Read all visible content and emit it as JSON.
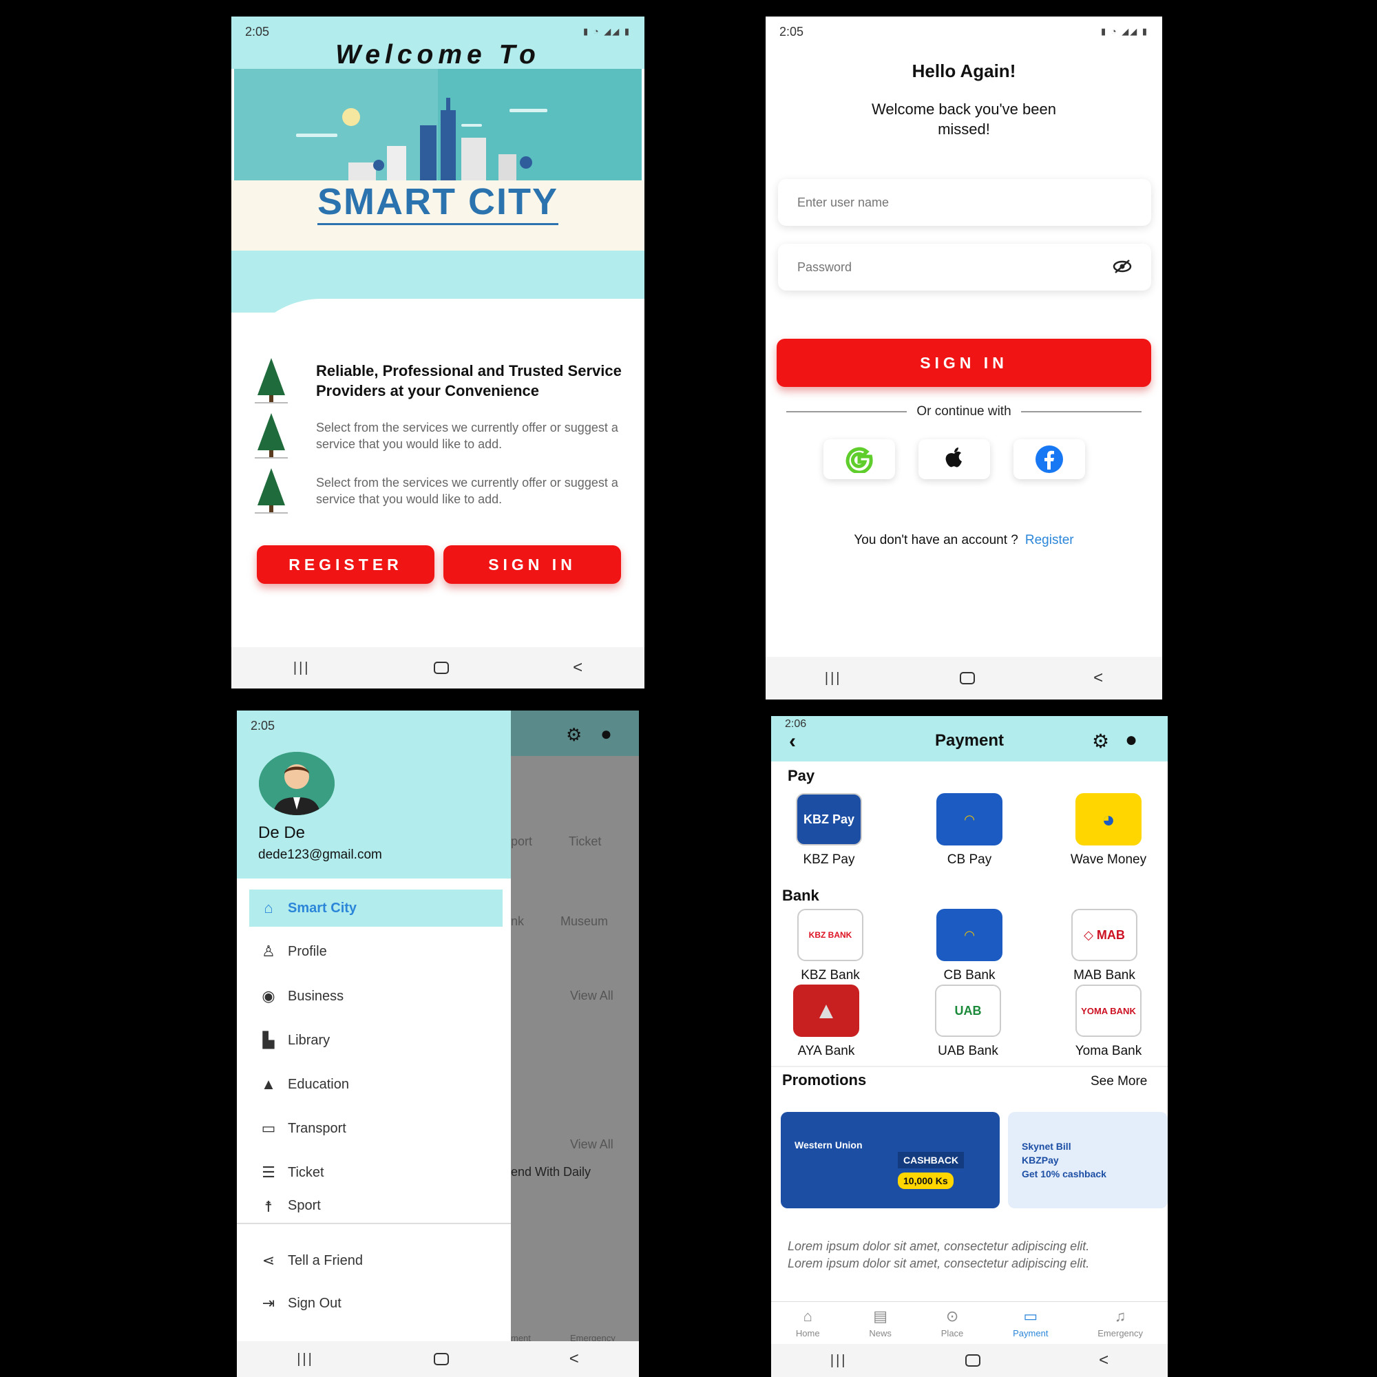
{
  "status_time_a": "2:05",
  "status_time_b": "2:06",
  "screen_welcome": {
    "heading": "Welcome To",
    "logo": "SMART CITY",
    "feature_title": "Reliable, Professional and Trusted Service Providers at your Convenience",
    "feature_text_1": "Select from the services we currently offer or suggest a service that you would like to add.",
    "feature_text_2": "Select from the services we currently offer or suggest a service that you would like to add.",
    "register_label": "REGISTER",
    "signin_label": "SIGN IN"
  },
  "screen_login": {
    "title": "Hello Again!",
    "subtitle": "Welcome back you've been missed!",
    "username_placeholder": "Enter user name",
    "password_placeholder": "Password",
    "signin_label": "SIGN IN",
    "continue_text": "Or continue with",
    "no_account": "You don't have an account ?",
    "register_link": "Register"
  },
  "screen_drawer": {
    "user_name": "De De",
    "user_email": "dede123@gmail.com",
    "menu": [
      "Smart City",
      "Profile",
      "Business",
      "Library",
      "Education",
      "Transport",
      "Ticket",
      "Sport"
    ],
    "tell_friend": "Tell a Friend",
    "sign_out": "Sign Out",
    "bg_ticket": "Ticket",
    "bg_museum": "Museum",
    "bg_view_all": "View All",
    "bg_view_all_2": "View All",
    "bg_port": "port",
    "bg_nk": "nk",
    "bg_daily": "end With Daily",
    "bg_ment": "ment",
    "bg_emergency": "Emergency"
  },
  "screen_payment": {
    "title": "Payment",
    "pay_title": "Pay",
    "pay": [
      "KBZ Pay",
      "CB Pay",
      "Wave Money"
    ],
    "bank_title": "Bank",
    "banks": [
      "KBZ Bank",
      "CB Bank",
      "MAB Bank",
      "AYA Bank",
      "UAB Bank",
      "Yoma Bank"
    ],
    "promotions_title": "Promotions",
    "see_more": "See More",
    "promo1_title": "Western Union",
    "promo1_badge": "CASHBACK",
    "promo1_amount": "10,000 Ks",
    "promo2_line1": "Skynet Bill",
    "promo2_line2": "KBZPay",
    "promo2_line3": "Get 10% cashback",
    "lorem_1": "Lorem ipsum dolor sit amet, consectetur adipiscing elit.",
    "lorem_2": "Lorem ipsum dolor sit amet, consectetur adipiscing elit.",
    "tabs": [
      "Home",
      "News",
      "Place",
      "Payment",
      "Emergency"
    ],
    "active_tab": "Payment"
  },
  "colors": {
    "accent": "#b2ecec",
    "brand_red": "#f11414",
    "link": "#2b86d9",
    "logo_blue": "#2a73ae"
  }
}
